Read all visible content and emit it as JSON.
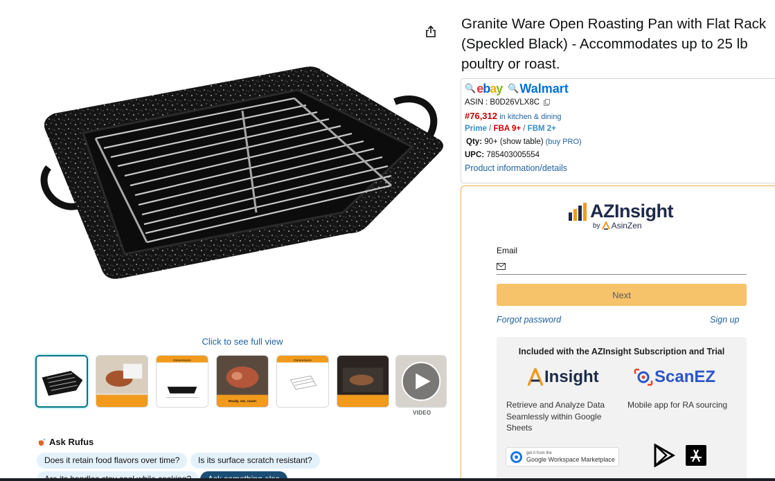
{
  "product": {
    "title": "Granite Ware Open Roasting Pan with Flat Rack (Speckled Black) - Accommodates up to 25 lb poultry or roast.",
    "see_full_view": "Click to see full view",
    "video_label": "VIDEO"
  },
  "thumbnails": [
    {
      "name": "thumb-roasting-pan",
      "caption": ""
    },
    {
      "name": "thumb-carving",
      "caption": ""
    },
    {
      "name": "thumb-dimensions-pan",
      "caption": "Dimensions"
    },
    {
      "name": "thumb-roast-ham",
      "caption": "Ready, set, roast!"
    },
    {
      "name": "thumb-dimensions-rack",
      "caption": "Dimensions"
    },
    {
      "name": "thumb-oven",
      "caption": ""
    },
    {
      "name": "thumb-video",
      "caption": ""
    }
  ],
  "rufus": {
    "label": "Ask Rufus",
    "chips": [
      "Does it retain food flavors over time?",
      "Is its surface scratch resistant?",
      "Are its handles stay cool while cooking?",
      "Ask something else"
    ]
  },
  "info": {
    "ebay_label": "ebay",
    "walmart_label": "Walmart",
    "asin_label": "ASIN : B0D26VLX8C",
    "rank": "#76,312",
    "category": "in kitchen & dining",
    "prime": "Prime",
    "fba": "FBA 9+",
    "fbm": "FBM 2+",
    "qty_label": "Qty:",
    "qty_value": "90+ (show table)",
    "buy_pro": "(buy PRO)",
    "upc_label": "UPC:",
    "upc_value": "785403005554",
    "details_link": "Product information/details"
  },
  "login": {
    "logo_text": "AZInsight",
    "by_text": "by",
    "asinzen": "AsinZen",
    "email_label": "Email",
    "email_value": "",
    "next_button": "Next",
    "forgot_password": "Forgot password",
    "sign_up": "Sign up"
  },
  "promo": {
    "title": "Included with the AZInsight Subscription and Trial",
    "insight_brand": "Insight",
    "scanez_brand": "ScanEZ",
    "insight_desc": "Retrieve and Analyze Data Seamlessly within Google Sheets",
    "scanez_desc": "Mobile app for RA sourcing",
    "gws_small": "get it from the",
    "gws_big": "Google Workspace Marketplace"
  },
  "colors": {
    "link": "#2162a1",
    "rank": "#c40000",
    "next_button": "#f6c26a",
    "panel_border": "#e9b544",
    "chip_bg": "#e3f1fb"
  }
}
